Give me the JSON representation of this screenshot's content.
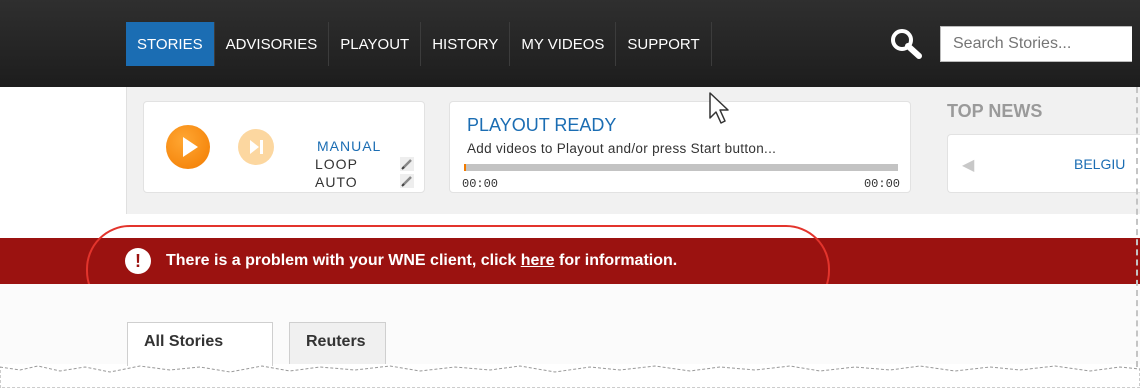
{
  "nav": {
    "items": [
      {
        "label": "STORIES",
        "active": true
      },
      {
        "label": "ADVISORIES",
        "active": false
      },
      {
        "label": "PLAYOUT",
        "active": false
      },
      {
        "label": "HISTORY",
        "active": false
      },
      {
        "label": "MY VIDEOS",
        "active": false
      },
      {
        "label": "SUPPORT",
        "active": false
      }
    ],
    "search_placeholder": "Search Stories..."
  },
  "player": {
    "modes": {
      "manual": "MANUAL",
      "loop": "LOOP",
      "auto": "AUTO"
    },
    "status_title": "PLAYOUT READY",
    "status_message": "Add videos to Playout and/or press Start button...",
    "progress": 0.005,
    "time_start": "00:00",
    "time_end": "00:00"
  },
  "top_news": {
    "title": "TOP NEWS",
    "item": "BELGIU"
  },
  "alert": {
    "text_before": "There is a problem with your WNE client, click ",
    "link_text": "here",
    "text_after": " for information.",
    "icon_glyph": "!"
  },
  "tabs": [
    {
      "label": "All Stories",
      "active": true
    },
    {
      "label": "Reuters",
      "active": false
    }
  ],
  "colors": {
    "accent_blue": "#1b6db3",
    "play_orange": "#f27b00",
    "alert_red": "#9b1210",
    "highlight_ring": "#e3342c"
  }
}
